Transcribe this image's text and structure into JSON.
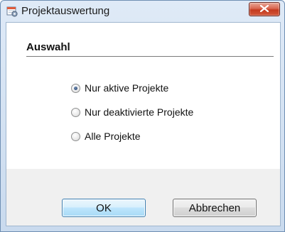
{
  "window": {
    "title": "Projektauswertung",
    "app_icon": "calendar-gear-icon",
    "close_icon": "close-icon"
  },
  "section": {
    "heading": "Auswahl"
  },
  "options": [
    {
      "label": "Nur aktive Projekte",
      "checked": true
    },
    {
      "label": "Nur deaktivierte Projekte",
      "checked": false
    },
    {
      "label": "Alle Projekte",
      "checked": false
    }
  ],
  "buttons": {
    "ok_label": "OK",
    "cancel_label": "Abbrechen"
  },
  "colors": {
    "titlebar": "#dfeaf7",
    "close_button": "#c43a1f",
    "ok_border": "#3c7fb1"
  }
}
